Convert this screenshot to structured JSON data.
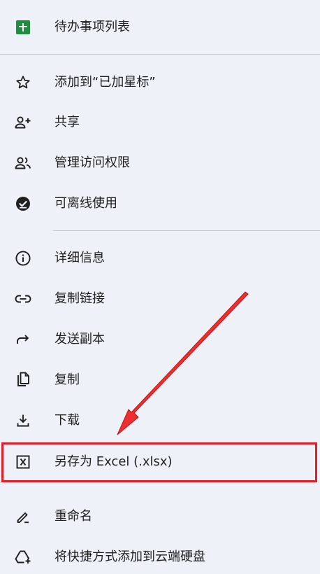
{
  "file": {
    "title": "待办事项列表",
    "icon": "google-sheets-icon",
    "icon_color": "#1e8e3e"
  },
  "menu": {
    "items": [
      {
        "label": "添加到“已加星标”",
        "icon": "star-icon"
      },
      {
        "label": "共享",
        "icon": "person-add-icon"
      },
      {
        "label": "管理访问权限",
        "icon": "people-icon"
      },
      {
        "label": "可离线使用",
        "icon": "offline-check-icon"
      },
      {
        "label": "详细信息",
        "icon": "info-icon"
      },
      {
        "label": "复制链接",
        "icon": "link-icon"
      },
      {
        "label": "发送副本",
        "icon": "forward-arrow-icon"
      },
      {
        "label": "复制",
        "icon": "copy-icon"
      },
      {
        "label": "下载",
        "icon": "download-icon"
      },
      {
        "label": "另存为 Excel (.xlsx)",
        "icon": "excel-icon"
      },
      {
        "label": "重命名",
        "icon": "pencil-icon"
      },
      {
        "label": "将快捷方式添加到云端硬盘",
        "icon": "add-shortcut-drive-icon"
      }
    ]
  },
  "colors": {
    "background": "#eef2f8",
    "text": "#1f1f1f",
    "icon": "#1f1f1f",
    "annotation": "#e01f26"
  }
}
